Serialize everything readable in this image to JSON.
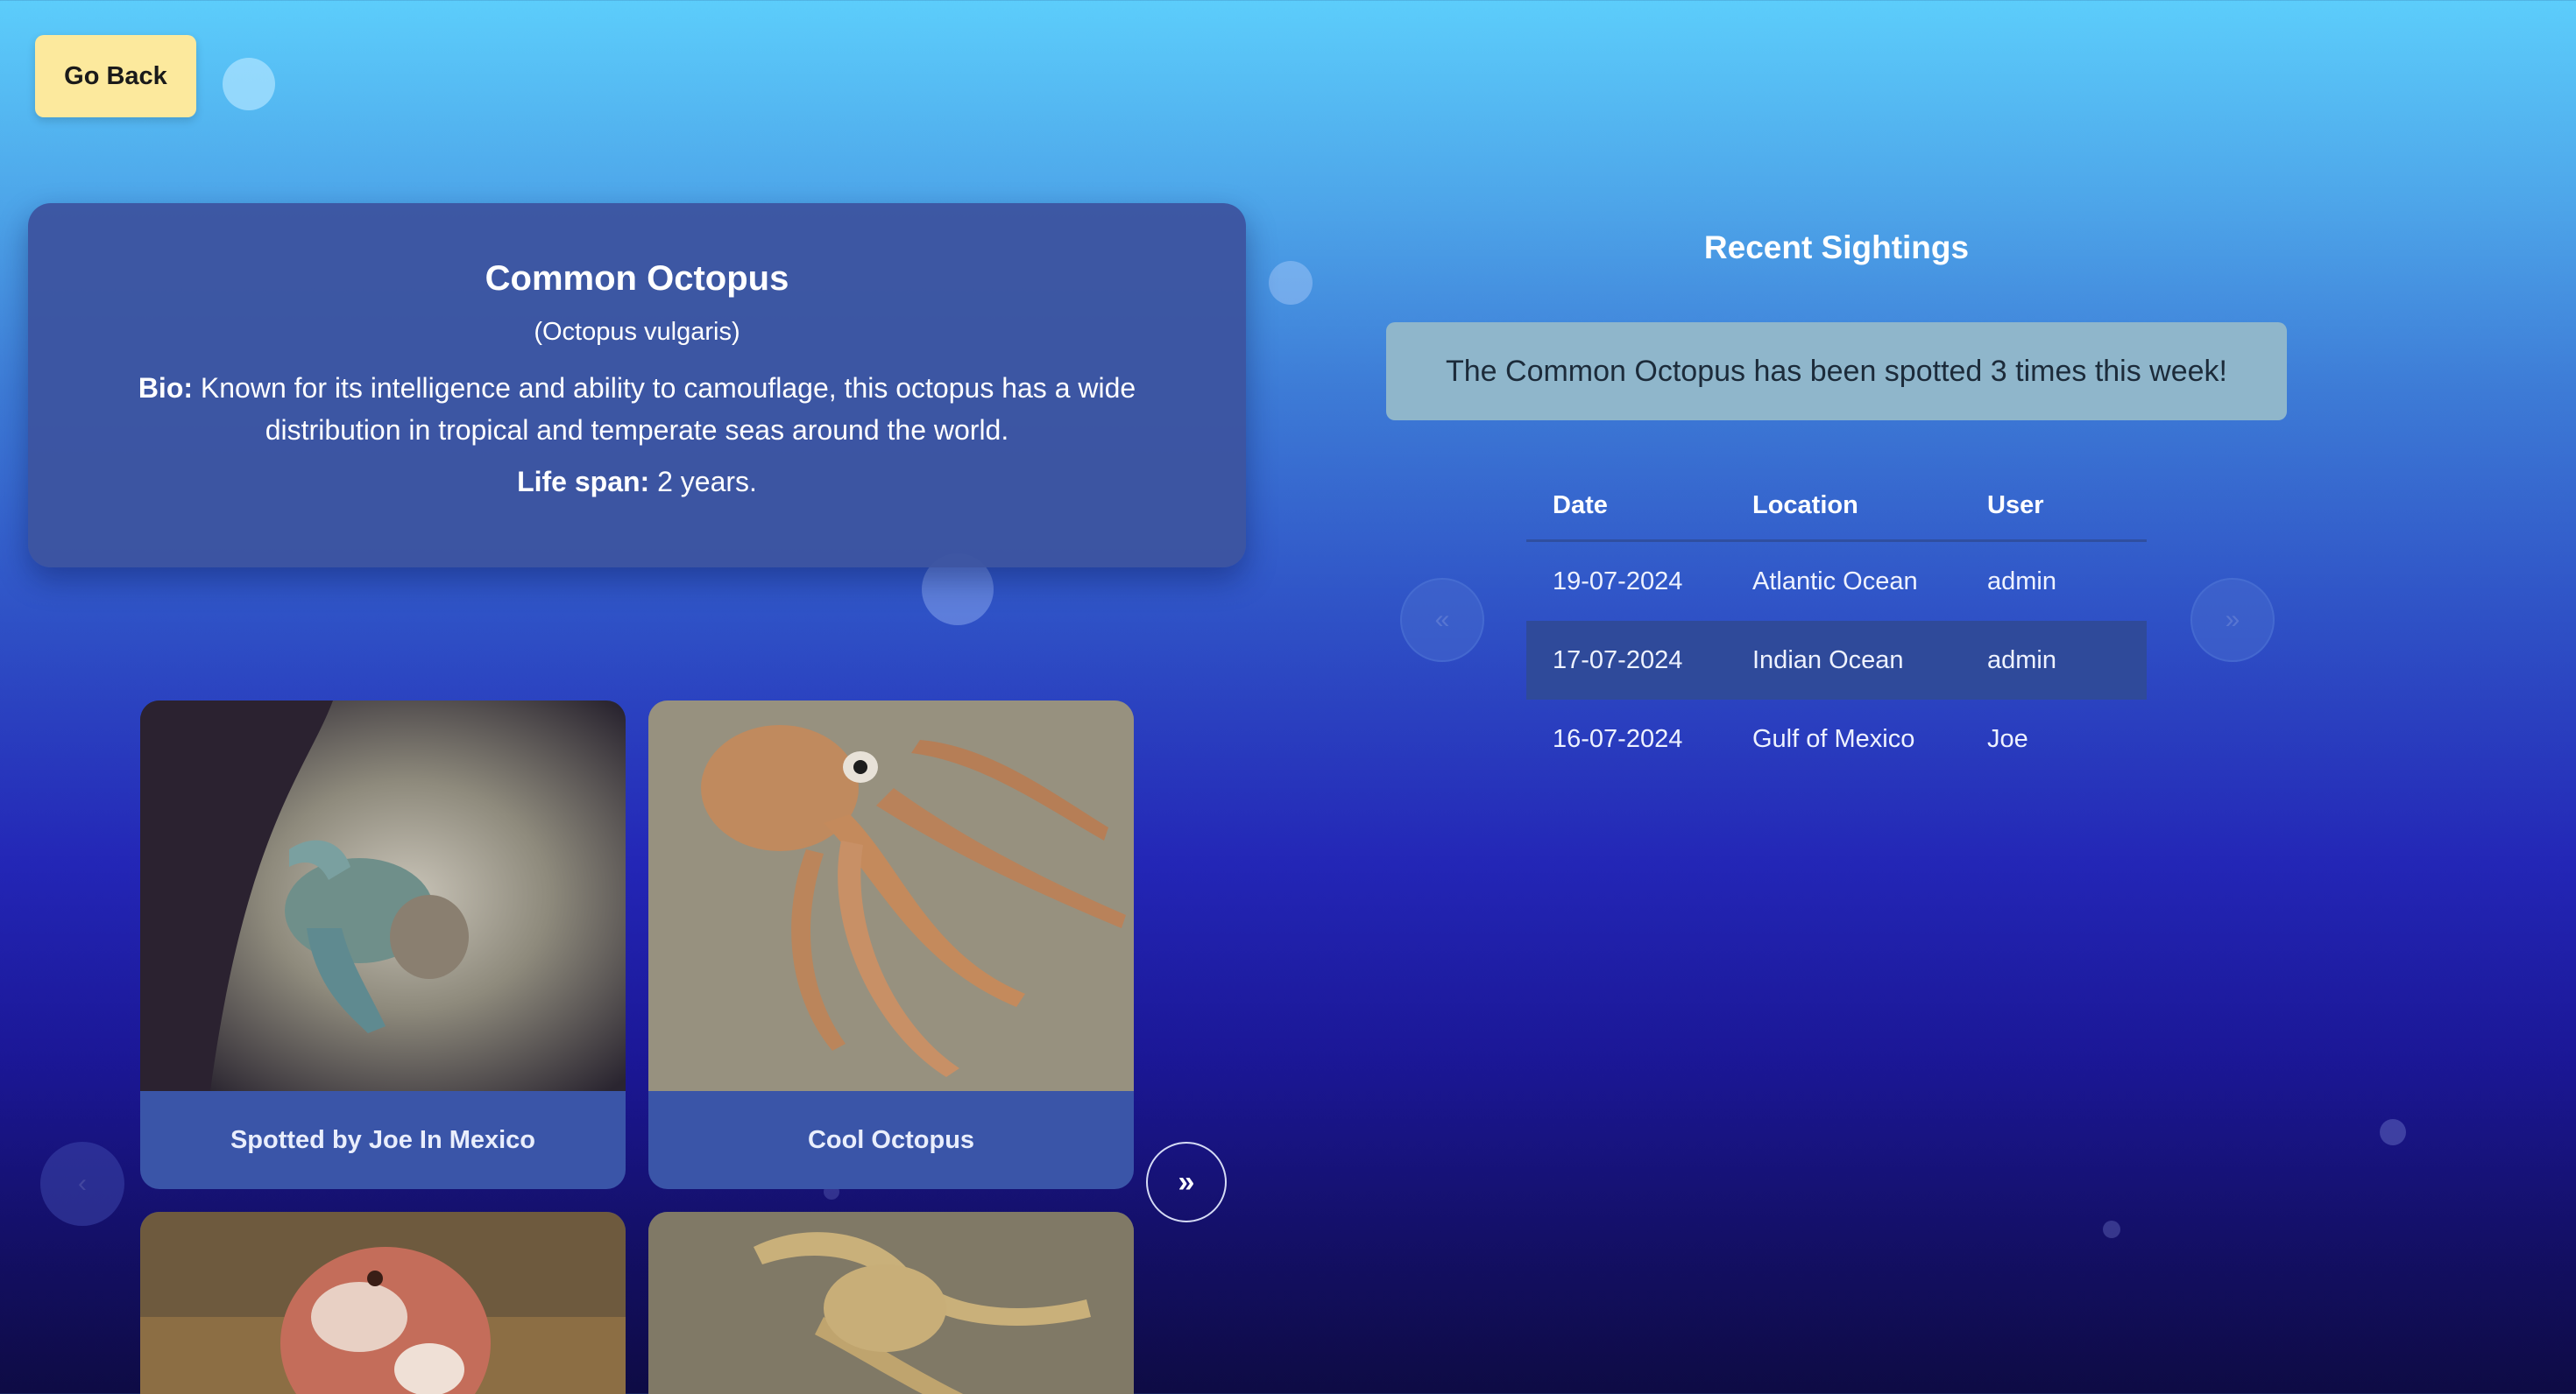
{
  "nav": {
    "back_label": "Go Back"
  },
  "species": {
    "name": "Common Octopus",
    "scientific_name": "(Octopus vulgaris)",
    "bio_label": "Bio:",
    "bio": "Known for its intelligence and ability to camouflage, this octopus has a wide distribution in tropical and temperate seas around the world.",
    "lifespan_label": "Life span:",
    "lifespan": "2 years."
  },
  "gallery": {
    "next_label": "»",
    "photos": [
      {
        "caption": "Spotted by Joe In Mexico"
      },
      {
        "caption": "Cool Octopus"
      },
      {
        "caption": ""
      },
      {
        "caption": ""
      }
    ]
  },
  "sightings": {
    "title": "Recent Sightings",
    "alert": "The Common Octopus has been spotted 3 times this week!",
    "prev_label": "«",
    "next_label": "»",
    "columns": [
      "Date",
      "Location",
      "User"
    ],
    "rows": [
      {
        "date": "19-07-2024",
        "location": "Atlantic Ocean",
        "user": "admin"
      },
      {
        "date": "17-07-2024",
        "location": "Indian Ocean",
        "user": "admin"
      },
      {
        "date": "16-07-2024",
        "location": "Gulf of Mexico",
        "user": "Joe"
      }
    ],
    "highlighted_row": 1
  },
  "colors": {
    "accent_button": "#fce99d",
    "card_bg": "#3c54a0",
    "alert_bg": "#8fb6cb"
  }
}
